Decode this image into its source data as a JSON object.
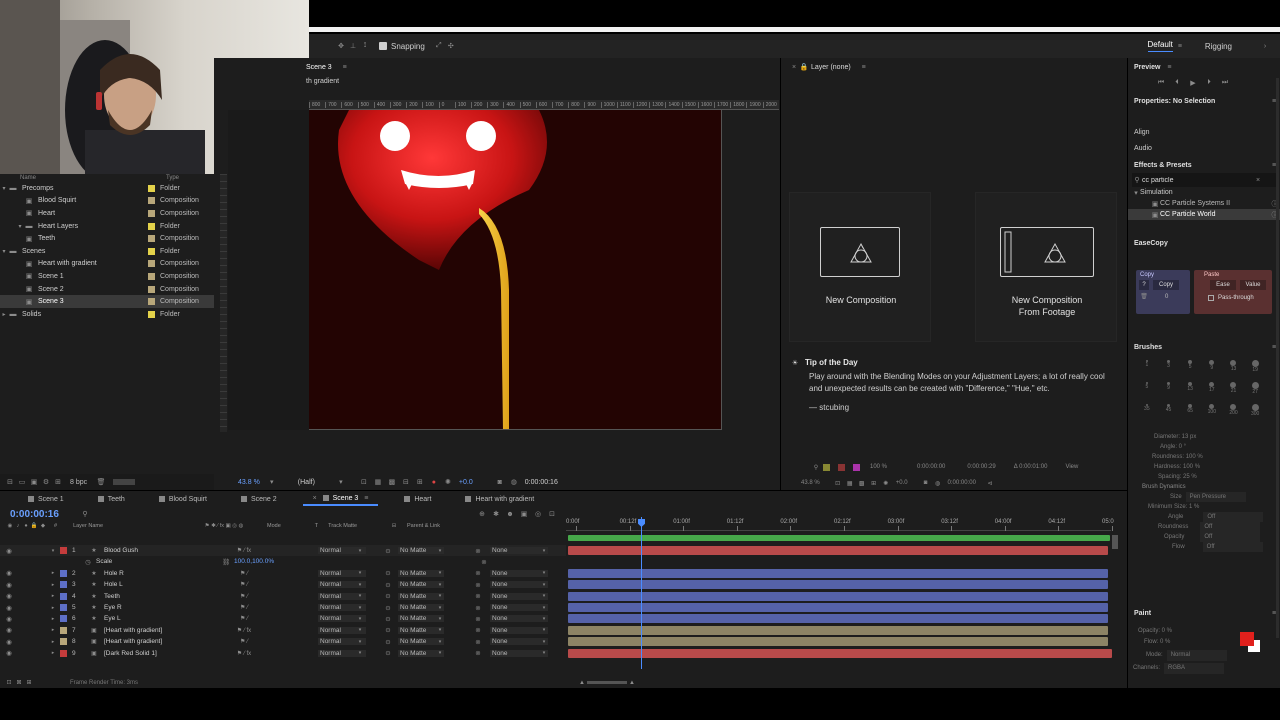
{
  "toolbar": {
    "snapping": "Snapping",
    "workspace_default": "Default",
    "workspace_rigging": "Rigging"
  },
  "comp_viewer": {
    "tab": "Scene 3",
    "breadcrumb": "th gradient",
    "zoom": "43.8 %",
    "resolution": "(Half)",
    "timecode": "0:00:00:16",
    "exposure": "+0.0",
    "ruler": [
      "800",
      "700",
      "600",
      "500",
      "400",
      "300",
      "200",
      "100",
      "0",
      "100",
      "200",
      "300",
      "400",
      "500",
      "600",
      "700",
      "800",
      "900",
      "1000",
      "1100",
      "1200",
      "1300",
      "1400",
      "1500",
      "1600",
      "1700",
      "1800",
      "1900",
      "2000"
    ]
  },
  "project": {
    "header_name": "Name",
    "header_type": "Type",
    "bpc": "8 bpc",
    "items": [
      {
        "name": "Precomps",
        "type": "Folder",
        "indent": 0,
        "kind": "folder",
        "swatch": "#e3d24a"
      },
      {
        "name": "Blood Squirt",
        "type": "Composition",
        "indent": 1,
        "kind": "comp",
        "swatch": "#b8a77a"
      },
      {
        "name": "Heart",
        "type": "Composition",
        "indent": 1,
        "kind": "comp",
        "swatch": "#b8a77a"
      },
      {
        "name": "Heart Layers",
        "type": "Folder",
        "indent": 1,
        "kind": "folder",
        "swatch": "#e3d24a"
      },
      {
        "name": "Teeth",
        "type": "Composition",
        "indent": 1,
        "kind": "comp",
        "swatch": "#b8a77a"
      },
      {
        "name": "Scenes",
        "type": "Folder",
        "indent": 0,
        "kind": "folder",
        "swatch": "#e3d24a"
      },
      {
        "name": "Heart with gradient",
        "type": "Composition",
        "indent": 1,
        "kind": "comp",
        "swatch": "#b8a77a"
      },
      {
        "name": "Scene 1",
        "type": "Composition",
        "indent": 1,
        "kind": "comp",
        "swatch": "#b8a77a"
      },
      {
        "name": "Scene 2",
        "type": "Composition",
        "indent": 1,
        "kind": "comp",
        "swatch": "#b8a77a"
      },
      {
        "name": "Scene 3",
        "type": "Composition",
        "indent": 1,
        "kind": "comp",
        "swatch": "#b8a77a",
        "selected": true
      },
      {
        "name": "Solids",
        "type": "Folder",
        "indent": 0,
        "kind": "folder",
        "swatch": "#e3d24a"
      }
    ]
  },
  "layer_panel": {
    "title": "Layer (none)"
  },
  "home": {
    "new_comp": "New Composition",
    "new_comp_footage_1": "New Composition",
    "new_comp_footage_2": "From Footage",
    "tip_title": "Tip of the Day",
    "tip_body": "Play around with the Blending Modes on your Adjustment Layers; a lot of really cool and unexpected results can be created with \"Difference,\" \"Hue,\" etc.",
    "tip_author": "— stcubing"
  },
  "right_panel": {
    "preview": "Preview",
    "properties": "Properties: No Selection",
    "align": "Align",
    "audio": "Audio",
    "effects": "Effects & Presets",
    "effects_search": "cc particle",
    "simulation": "Simulation",
    "effect_1": "CC Particle Systems II",
    "effect_2": "CC Particle World",
    "easecopy": "EaseCopy",
    "copy_label": "Copy",
    "paste_label": "Paste",
    "copy_btn": "Copy",
    "ease_btn": "Ease",
    "value_btn": "Value",
    "q_btn": "?",
    "zero": "0",
    "pass_through": "Pass-through",
    "brushes": "Brushes",
    "brush_sizes": [
      "1",
      "3",
      "5",
      "9",
      "13",
      "19",
      "5",
      "9",
      "13",
      "17",
      "21",
      "27",
      "35",
      "45",
      "65",
      "100",
      "200",
      "300"
    ],
    "diameter": "Diameter: 13 px",
    "angle": "Angle: 0 °",
    "roundness": "Roundness: 100 %",
    "hardness": "Hardness: 100 %",
    "spacing": "Spacing: 25 %",
    "brush_dynamics": "Brush Dynamics",
    "size": "Size",
    "size_val": "Pen Pressure",
    "min_size": "Minimum Size: 1 %",
    "dyn_angle": "Angle",
    "dyn_roundness": "Roundness",
    "opacity": "Opacity",
    "flow": "Flow",
    "off": "Off",
    "paint": "Paint",
    "paint_opacity": "Opacity: 0 %",
    "paint_flow": "Flow: 0 %",
    "mode": "Mode:",
    "mode_val": "Normal",
    "channels": "Channels:",
    "channels_val": "RGBA",
    "paint_color": "#e0201c"
  },
  "layer_viewer_bar": {
    "zoom": "43.8 %",
    "t1": "0:00:00:00",
    "t2": "0:00:00:29",
    "t3": "Δ 0:00:01:00",
    "pct": "100 %",
    "view": "View",
    "tc": "0:00:00:00",
    "exp": "+0.0"
  },
  "timeline": {
    "tabs": [
      "Scene 1",
      "Teeth",
      "Blood Squirt",
      "Scene 2",
      "Scene 3",
      "Heart",
      "Heart with gradient"
    ],
    "active_tab": 4,
    "timecode": "0:00:00:16",
    "timecode_sub": "00016 (29.97 fps)",
    "col_num": "#",
    "col_name": "Layer Name",
    "col_mode": "Mode",
    "col_t": "T",
    "col_track": "Track Matte",
    "col_parent": "Parent & Link",
    "ruler": [
      "0:00f",
      "00:12f",
      "01:00f",
      "01:12f",
      "02:00f",
      "02:12f",
      "03:00f",
      "03:12f",
      "04:00f",
      "04:12f",
      "05:0"
    ],
    "mode_normal": "Normal",
    "matte_none": "No Matte",
    "parent_none": "None",
    "scale_label": "Scale",
    "scale_value": "100.0,100.0%",
    "layers": [
      {
        "num": "1",
        "name": "Blood Gush",
        "label": "#c43c3c",
        "bar": "#b84a4a",
        "top_bar": "#5aa34f"
      },
      {
        "num": "2",
        "name": "Hole R",
        "label": "#5d6fc7",
        "bar": "#5562a8"
      },
      {
        "num": "3",
        "name": "Hole L",
        "label": "#5d6fc7",
        "bar": "#5562a8"
      },
      {
        "num": "4",
        "name": "Teeth",
        "label": "#5d6fc7",
        "bar": "#5562a8"
      },
      {
        "num": "5",
        "name": "Eye R",
        "label": "#5d6fc7",
        "bar": "#5562a8"
      },
      {
        "num": "6",
        "name": "Eye L",
        "label": "#5d6fc7",
        "bar": "#5562a8"
      },
      {
        "num": "7",
        "name": "[Heart with gradient]",
        "label": "#b8a77a",
        "bar": "#8d8465"
      },
      {
        "num": "8",
        "name": "[Heart with gradient]",
        "label": "#b8a77a",
        "bar": "#8d8465"
      },
      {
        "num": "9",
        "name": "[Dark Red Solid 1]",
        "label": "#c43c3c",
        "bar": "#b84a4a"
      }
    ],
    "footer": "Frame Render Time: 3ms"
  }
}
